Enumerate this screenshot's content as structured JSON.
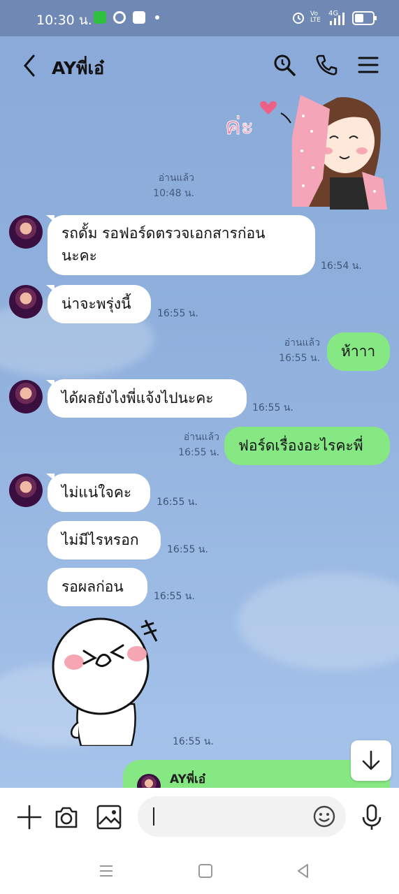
{
  "status": {
    "time": "10:30 น.",
    "net_label": "4G",
    "volte_label": "Vo LTE"
  },
  "header": {
    "title": "AYพี่เอ๋",
    "icons": [
      "back-icon",
      "search-icon",
      "phone-icon",
      "menu-icon"
    ]
  },
  "messages": [
    {
      "side": "me",
      "type": "sticker",
      "sticker_text": "ค่ะ",
      "read": "อ่านแล้ว",
      "time": "10:48 น."
    },
    {
      "side": "them",
      "type": "text",
      "lines": [
        "รถดั้ม รอฟอร์ดตรวจเอกสารก่อน",
        "นะคะ"
      ],
      "time": "16:54 น."
    },
    {
      "side": "them",
      "type": "text",
      "lines": [
        "น่าจะพรุ่งนี้"
      ],
      "time": "16:55 น."
    },
    {
      "side": "me",
      "type": "text",
      "lines": [
        "ห้าาา"
      ],
      "read": "อ่านแล้ว",
      "time": "16:55 น."
    },
    {
      "side": "them",
      "type": "text",
      "lines": [
        "ได้ผลยังไงพี่แจ้งไปนะคะ"
      ],
      "time": "16:55 น."
    },
    {
      "side": "me",
      "type": "text",
      "lines": [
        "ฟอร์ดเรื่องอะไรคะพี่"
      ],
      "read": "อ่านแล้ว",
      "time": "16:55 น."
    },
    {
      "side": "them",
      "type": "text",
      "lines": [
        "ไม่แน่ใจคะ"
      ],
      "time": "16:55 น."
    },
    {
      "side": "them",
      "type": "text",
      "lines": [
        "ไม่มีไรหรอก"
      ],
      "time": "16:55 น."
    },
    {
      "side": "them",
      "type": "text",
      "lines": [
        "รอผลก่อน"
      ],
      "time": "16:55 น."
    },
    {
      "side": "them",
      "type": "sticker",
      "time": "16:55 น."
    }
  ],
  "reply_preview": {
    "name": "AYพี่เอ๋"
  },
  "input": {
    "placeholder": ""
  },
  "colors": {
    "status_bar": "#6f89b4",
    "chat_bg": "#8eabd9",
    "my_bubble": "#86e883",
    "their_bubble": "#ffffff"
  }
}
